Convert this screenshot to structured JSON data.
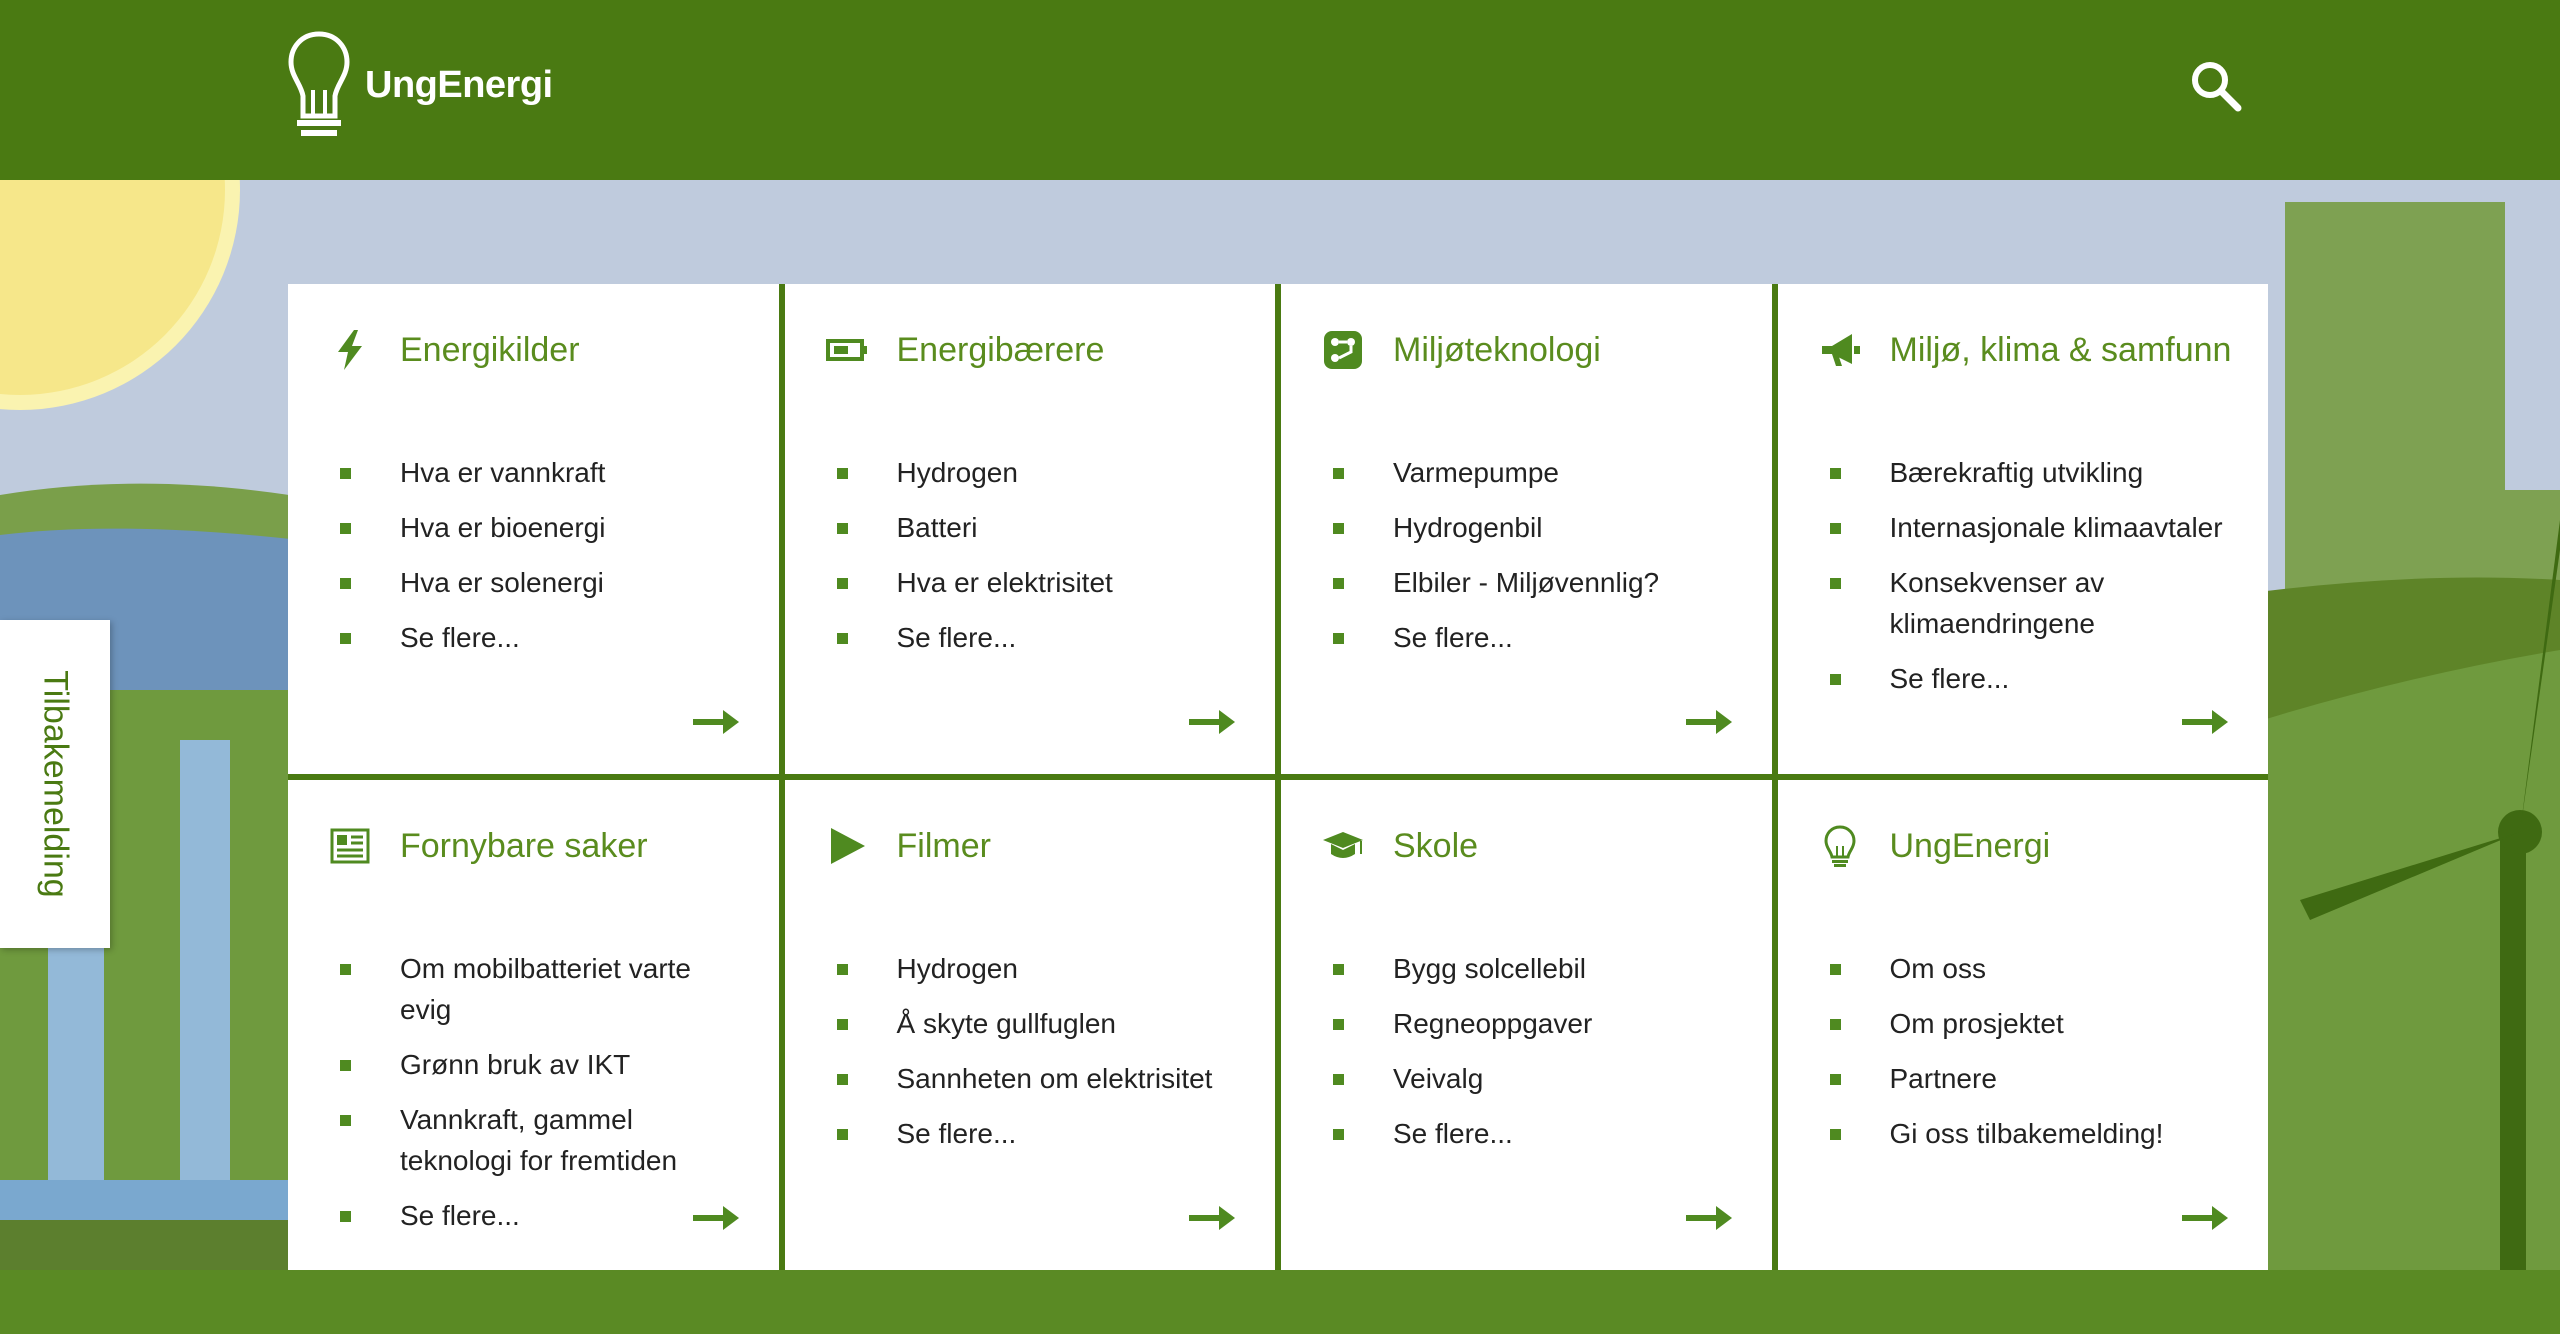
{
  "header": {
    "logo_text": "UngEnergi",
    "brand_color": "#4a7a12",
    "search_icon": "search-icon"
  },
  "feedback": {
    "label": "Tilbakemelding"
  },
  "cards": [
    {
      "title": "Energikilder",
      "icon": "lightning-icon",
      "items": [
        "Hva er vannkraft",
        "Hva er bioenergi",
        "Hva er solenergi",
        "Se flere..."
      ]
    },
    {
      "title": "Energibærere",
      "icon": "battery-icon",
      "items": [
        "Hydrogen",
        "Batteri",
        "Hva er elektrisitet",
        "Se flere..."
      ]
    },
    {
      "title": "Miljøteknologi",
      "icon": "circuit-icon",
      "items": [
        "Varmepumpe",
        "Hydrogenbil",
        "Elbiler - Miljøvennlig?",
        "Se flere..."
      ]
    },
    {
      "title": "Miljø, klima & samfunn",
      "icon": "megaphone-icon",
      "items": [
        "Bærekraftig utvikling",
        "Internasjonale klimaavtaler",
        "Konsekvenser av klimaendringene",
        "Se flere..."
      ]
    },
    {
      "title": "Fornybare saker",
      "icon": "newspaper-icon",
      "items": [
        "Om mobilbatteriet varte evig",
        "Grønn bruk av IKT",
        "Vannkraft, gammel teknologi for fremtiden",
        "Se flere..."
      ]
    },
    {
      "title": "Filmer",
      "icon": "play-icon",
      "items": [
        "Hydrogen",
        "Å skyte gullfuglen",
        "Sannheten om elektrisitet",
        "Se flere..."
      ]
    },
    {
      "title": "Skole",
      "icon": "graduation-cap-icon",
      "items": [
        "Bygg solcellebil",
        "Regneoppgaver",
        "Veivalg",
        "Se flere..."
      ]
    },
    {
      "title": "UngEnergi",
      "icon": "lightbulb-icon",
      "items": [
        "Om oss",
        "Om prosjektet",
        "Partnere",
        "Gi oss tilbakemelding!"
      ]
    }
  ]
}
